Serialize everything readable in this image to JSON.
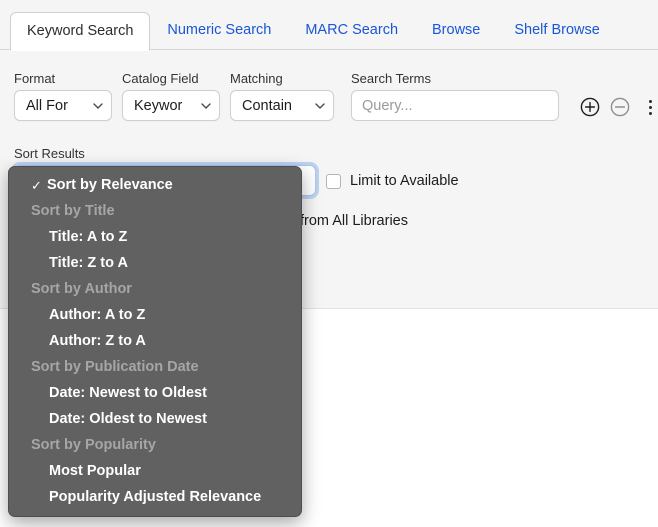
{
  "tabs": [
    {
      "label": "Keyword Search",
      "active": true
    },
    {
      "label": "Numeric Search",
      "active": false
    },
    {
      "label": "MARC Search",
      "active": false
    },
    {
      "label": "Browse",
      "active": false
    },
    {
      "label": "Shelf Browse",
      "active": false
    }
  ],
  "form": {
    "format": {
      "label": "Format",
      "value": "All For"
    },
    "catalog_field": {
      "label": "Catalog Field",
      "value": "Keywor"
    },
    "matching": {
      "label": "Matching",
      "value": "Contain"
    },
    "search_terms": {
      "label": "Search Terms",
      "value": "",
      "placeholder": "Query..."
    },
    "add_row_icon": "plus-circle-icon",
    "remove_row_icon": "minus-circle-icon",
    "more_options_icon": "kebab-menu-icon"
  },
  "sort": {
    "label": "Sort Results",
    "selected": "Sort by Relevance"
  },
  "limit_to_available": {
    "label": "Limit to Available",
    "checked": false
  },
  "libraries_text": "from All Libraries",
  "dropdown": {
    "entries": [
      {
        "type": "item",
        "label": "Sort by Relevance",
        "selected": true,
        "check": "✓"
      },
      {
        "type": "group",
        "label": "Sort by Title"
      },
      {
        "type": "item",
        "label": "Title: A to Z",
        "selected": false
      },
      {
        "type": "item",
        "label": "Title: Z to A",
        "selected": false
      },
      {
        "type": "group",
        "label": "Sort by Author"
      },
      {
        "type": "item",
        "label": "Author: A to Z",
        "selected": false
      },
      {
        "type": "item",
        "label": "Author: Z to A",
        "selected": false
      },
      {
        "type": "group",
        "label": "Sort by Publication Date"
      },
      {
        "type": "item",
        "label": "Date: Newest to Oldest",
        "selected": false
      },
      {
        "type": "item",
        "label": "Date: Oldest to Newest",
        "selected": false
      },
      {
        "type": "group",
        "label": "Sort by Popularity"
      },
      {
        "type": "item",
        "label": "Most Popular",
        "selected": false
      },
      {
        "type": "item",
        "label": "Popularity Adjusted Relevance",
        "selected": false
      }
    ]
  },
  "colors": {
    "tab_link": "#1a56d6",
    "panel_bg": "#f5f5f5",
    "menu_bg": "#616161",
    "focus_ring": "#78aaeb"
  }
}
